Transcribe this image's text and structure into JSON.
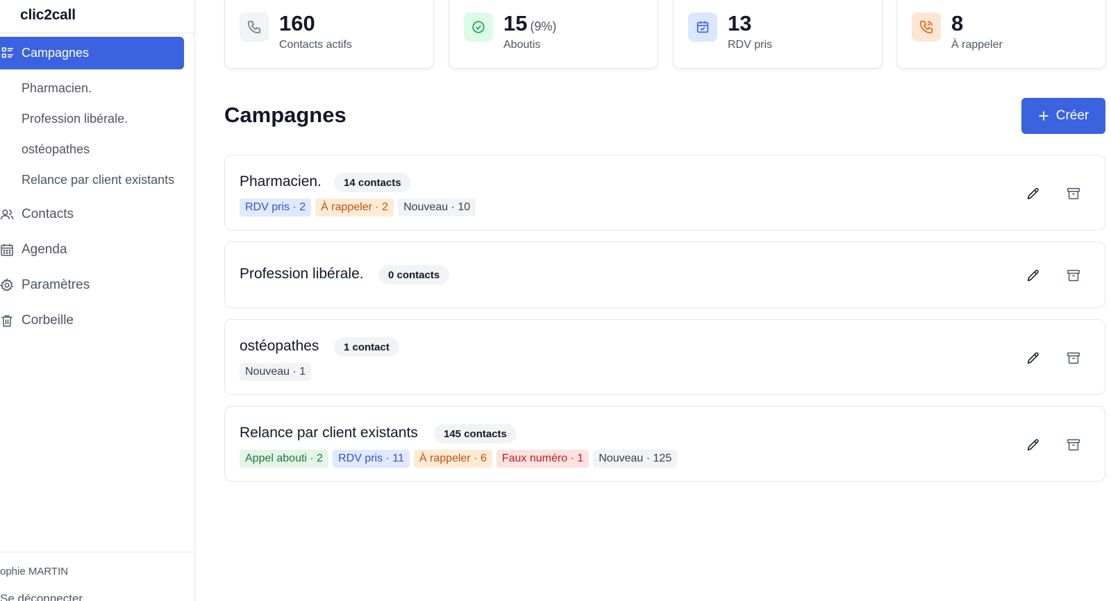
{
  "app": {
    "brand": "clic2call"
  },
  "sidebar": {
    "active": {
      "label": "Campagnes",
      "icon": "campaign-list-icon"
    },
    "sub_items": [
      "Pharmacien.",
      "Profession libérale.",
      "ostéopathes",
      "Relance par client existants"
    ],
    "nav": [
      {
        "label": "Contacts",
        "icon": "users-icon"
      },
      {
        "label": "Agenda",
        "icon": "calendar-icon"
      },
      {
        "label": "Paramètres",
        "icon": "gear-icon"
      },
      {
        "label": "Corbeille",
        "icon": "trash-icon"
      }
    ],
    "user": "ophie MARTIN",
    "logout": "Se déconnecter"
  },
  "stats": [
    {
      "value": "160",
      "pct": "",
      "label": "Contacts actifs",
      "icon": "phone-icon",
      "color": "#6b7280",
      "bg": "#f1f3f5"
    },
    {
      "value": "15",
      "pct": "(9%)",
      "label": "Aboutis",
      "icon": "check-circle-icon",
      "color": "#16a34a",
      "bg": "#dcfce7"
    },
    {
      "value": "13",
      "pct": "",
      "label": "RDV pris",
      "icon": "calendar-check-icon",
      "color": "#3b63e0",
      "bg": "#dbe7ff"
    },
    {
      "value": "8",
      "pct": "",
      "label": "À rappeler",
      "icon": "phone-callback-icon",
      "color": "#ea580c",
      "bg": "#fde6d2"
    }
  ],
  "header": {
    "title": "Campagnes",
    "create_label": "Créer"
  },
  "campaigns": [
    {
      "name": "Pharmacien.",
      "count": "14 contacts",
      "tags": [
        {
          "text": "RDV pris · 2",
          "kind": "blue"
        },
        {
          "text": "À rappeler · 2",
          "kind": "orange"
        },
        {
          "text": "Nouveau · 10",
          "kind": "gray"
        }
      ]
    },
    {
      "name": "Profession libérale.",
      "count": "0 contacts",
      "tags": []
    },
    {
      "name": "ostéopathes",
      "count": "1 contact",
      "tags": [
        {
          "text": "Nouveau · 1",
          "kind": "gray"
        }
      ]
    },
    {
      "name": "Relance par client existants",
      "count": "145 contacts",
      "tags": [
        {
          "text": "Appel abouti · 2",
          "kind": "green"
        },
        {
          "text": "RDV pris · 11",
          "kind": "blue"
        },
        {
          "text": "À rappeler · 6",
          "kind": "orange"
        },
        {
          "text": "Faux numéro · 1",
          "kind": "red"
        },
        {
          "text": "Nouveau · 125",
          "kind": "gray"
        }
      ]
    }
  ],
  "colors": {
    "accent": "#3b63e0",
    "border": "#e5e7eb",
    "muted_text": "#4b5563"
  }
}
